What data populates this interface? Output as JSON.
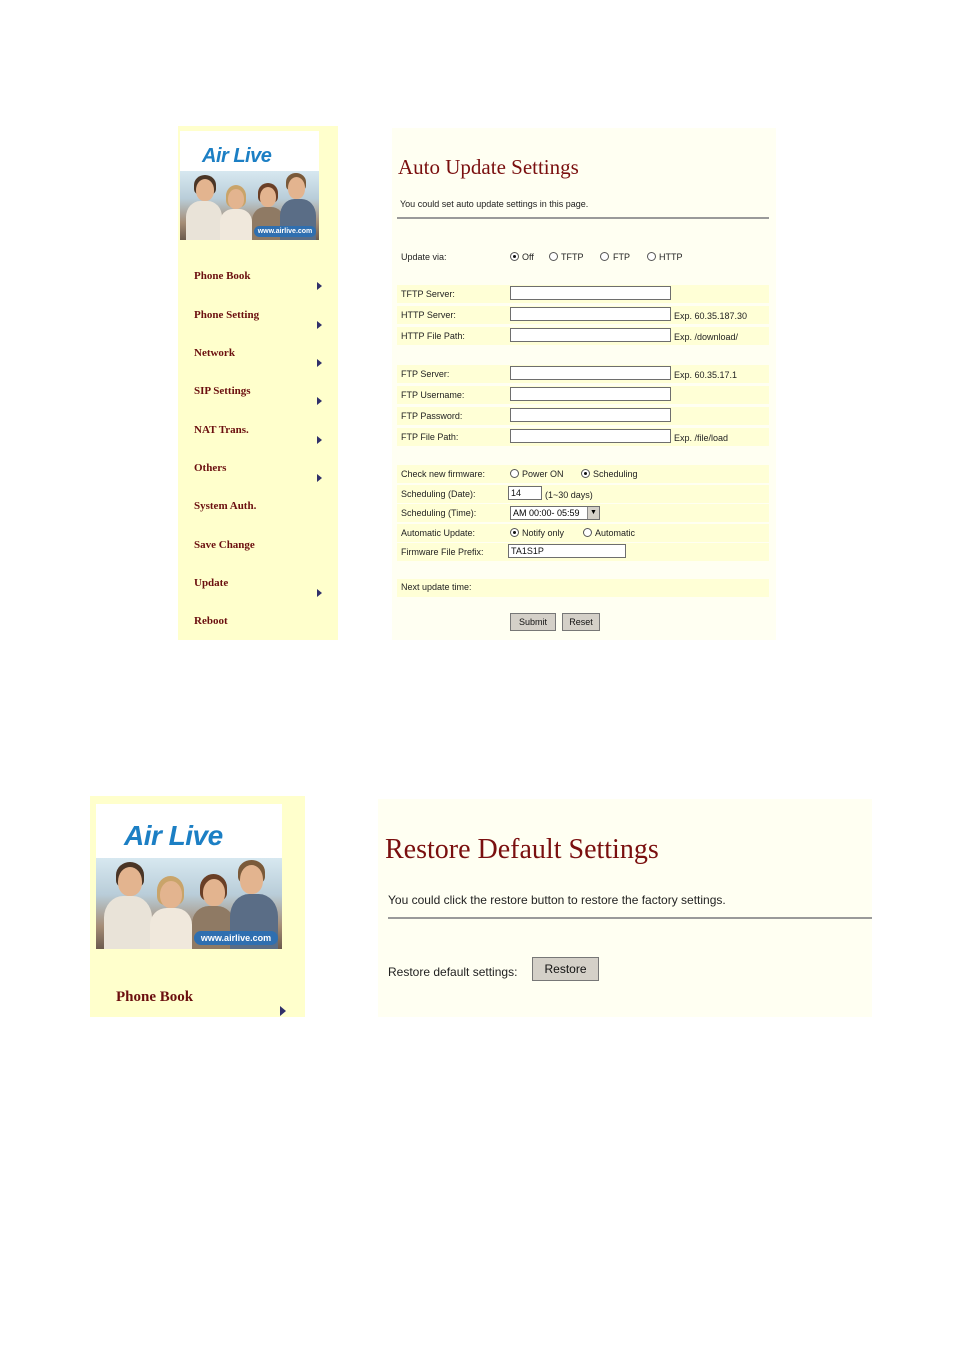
{
  "screen1": {
    "logo": {
      "brand": "Air Live",
      "url": "www.airlive.com"
    },
    "nav": [
      {
        "label": "Phone Book",
        "arrow": true
      },
      {
        "label": "Phone Setting",
        "arrow": true
      },
      {
        "label": "Network",
        "arrow": true
      },
      {
        "label": "SIP Settings",
        "arrow": true
      },
      {
        "label": "NAT Trans.",
        "arrow": true
      },
      {
        "label": "Others",
        "arrow": true
      },
      {
        "label": "System Auth.",
        "arrow": false
      },
      {
        "label": "Save Change",
        "arrow": false
      },
      {
        "label": "Update",
        "arrow": true
      },
      {
        "label": "Reboot",
        "arrow": false
      }
    ],
    "title": "Auto Update Settings",
    "description": "You could set auto update settings in this page.",
    "update_via": {
      "label": "Update via:",
      "options": [
        "Off",
        "TFTP",
        "FTP",
        "HTTP"
      ],
      "selected": "Off"
    },
    "tftp_server": {
      "label": "TFTP Server:",
      "value": ""
    },
    "http_server": {
      "label": "HTTP Server:",
      "value": "",
      "hint": "Exp. 60.35.187.30"
    },
    "http_file_path": {
      "label": "HTTP File Path:",
      "value": "",
      "hint": "Exp. /download/"
    },
    "ftp_server": {
      "label": "FTP Server:",
      "value": "",
      "hint": "Exp. 60.35.17.1"
    },
    "ftp_username": {
      "label": "FTP Username:",
      "value": ""
    },
    "ftp_password": {
      "label": "FTP Password:",
      "value": ""
    },
    "ftp_file_path": {
      "label": "FTP File Path:",
      "value": "",
      "hint": "Exp. /file/load"
    },
    "check_firmware": {
      "label": "Check new firmware:",
      "options": [
        "Power ON",
        "Scheduling"
      ],
      "selected": "Scheduling"
    },
    "sched_date": {
      "label": "Scheduling (Date):",
      "value": "14",
      "hint": "(1~30 days)"
    },
    "sched_time": {
      "label": "Scheduling (Time):",
      "value": "AM 00:00- 05:59"
    },
    "auto_update": {
      "label": "Automatic Update:",
      "options": [
        "Notify only",
        "Automatic"
      ],
      "selected": "Notify only"
    },
    "fw_prefix": {
      "label": "Firmware File Prefix:",
      "value": "TA1S1P"
    },
    "next_update": {
      "label": "Next update time:"
    },
    "buttons": {
      "submit": "Submit",
      "reset": "Reset"
    }
  },
  "screen2": {
    "logo": {
      "brand": "Air Live",
      "url": "www.airlive.com"
    },
    "nav": [
      {
        "label": "Phone Book",
        "arrow": true
      }
    ],
    "title": "Restore Default Settings",
    "description": "You could click the restore button to restore the factory settings.",
    "restore_label": "Restore default settings:",
    "restore_button": "Restore"
  },
  "colors": {
    "sidebar_bg": "#ffffcc",
    "row_bg": "#ffffd6",
    "title": "#7a0f0f",
    "nav_text": "#6b0f0f",
    "brand": "#1c7fc4"
  }
}
